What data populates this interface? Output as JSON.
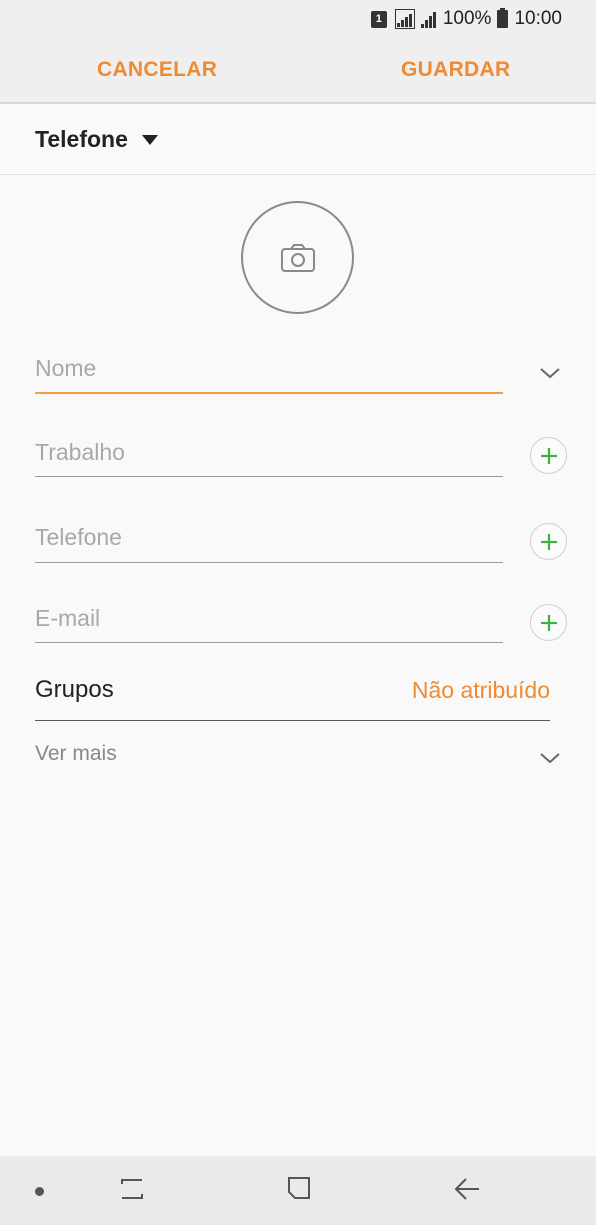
{
  "status": {
    "sim_slot": "1",
    "battery": "100%",
    "time": "10:00"
  },
  "actions": {
    "cancel": "CANCELAR",
    "save": "GUARDAR"
  },
  "account": {
    "label": "Telefone"
  },
  "fields": {
    "name": {
      "placeholder": "Nome"
    },
    "work": {
      "placeholder": "Trabalho"
    },
    "phone": {
      "placeholder": "Telefone"
    },
    "email": {
      "placeholder": "E-mail"
    }
  },
  "groups": {
    "label": "Grupos",
    "value": "Não atribuído"
  },
  "more": {
    "label": "Ver mais"
  },
  "colors": {
    "accent": "#ee8a32",
    "add_green": "#3cb043"
  }
}
